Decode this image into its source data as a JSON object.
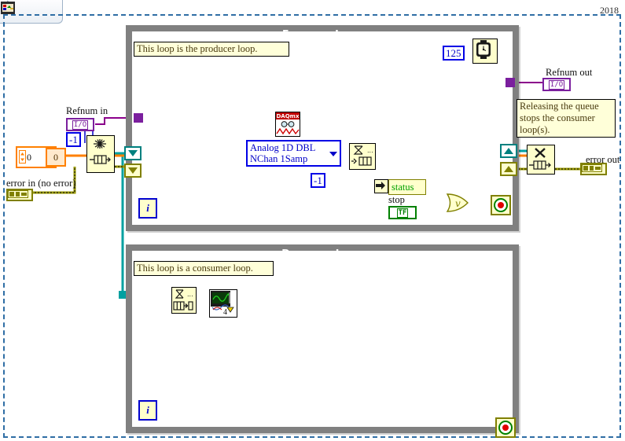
{
  "window": {
    "year_label": "2018",
    "toolbar": {
      "items": [
        {
          "name": "hand-tool-icon",
          "label": "hand"
        },
        {
          "name": "arrow-right-icon",
          "label": "run-arrow"
        },
        {
          "name": "vi-icon",
          "label": "vi"
        }
      ]
    }
  },
  "loops": {
    "enqueue": {
      "title": "Enqueue Loop",
      "comment": "This loop is the producer loop.",
      "iteration_label": "i",
      "wait_constant": "125"
    },
    "dequeue": {
      "title": "Dequeue Loop",
      "comment": "This loop is a consumer loop.",
      "iteration_label": "i",
      "chart_instance": "4"
    }
  },
  "terminals": {
    "refnum_in_label": "Refnum in",
    "refnum_in_value": "I/O",
    "refnum_out_label": "Refnum out",
    "refnum_out_value": "I/O",
    "error_in_label": "error in (no error)",
    "error_out_label": "error out",
    "queue_size_value": "-1",
    "read_samples_value": "-1",
    "numeric_control_value": "0",
    "numeric_constant_value": "0",
    "status_label": "status",
    "stop_label": "stop",
    "stop_value": "TF"
  },
  "nodes": {
    "obtain_queue": {
      "name": "obtain-queue",
      "glyph": "queue"
    },
    "daqmx_read": {
      "name": "daqmx-read",
      "badge": "DAQmx"
    },
    "read_mode": {
      "name": "daqmx-read-mode-ring",
      "line1": "Analog 1D DBL",
      "line2": "NChan 1Samp"
    },
    "enqueue_element": {
      "name": "enqueue-element",
      "glyph": "enqueue"
    },
    "dequeue_element": {
      "name": "dequeue-element",
      "glyph": "dequeue"
    },
    "release_queue": {
      "name": "release-queue",
      "glyph": "X"
    },
    "wait_ms": {
      "name": "wait-ms-timer",
      "glyph": "clock"
    },
    "or_gate": {
      "name": "or-gate",
      "glyph": "v"
    },
    "waveform_chart": {
      "name": "waveform-chart",
      "glyph": "chart"
    },
    "unbundle_status": {
      "name": "unbundle-error-status",
      "glyph": "arrow"
    }
  },
  "comments": {
    "release_note": "Releasing the queue\nstops the consumer\nloop(s)."
  },
  "colors": {
    "wire_error": "#999900",
    "wire_dynamic_orange": "#ff8000",
    "wire_refnum": "#8b008b",
    "wire_teal": "#00a0a0",
    "wire_boolean": "#00a000",
    "wire_blue": "#0000c8",
    "loop_border": "#808080",
    "diagram_border": "#2f6ea5",
    "node_fill": "#ffffcc"
  }
}
